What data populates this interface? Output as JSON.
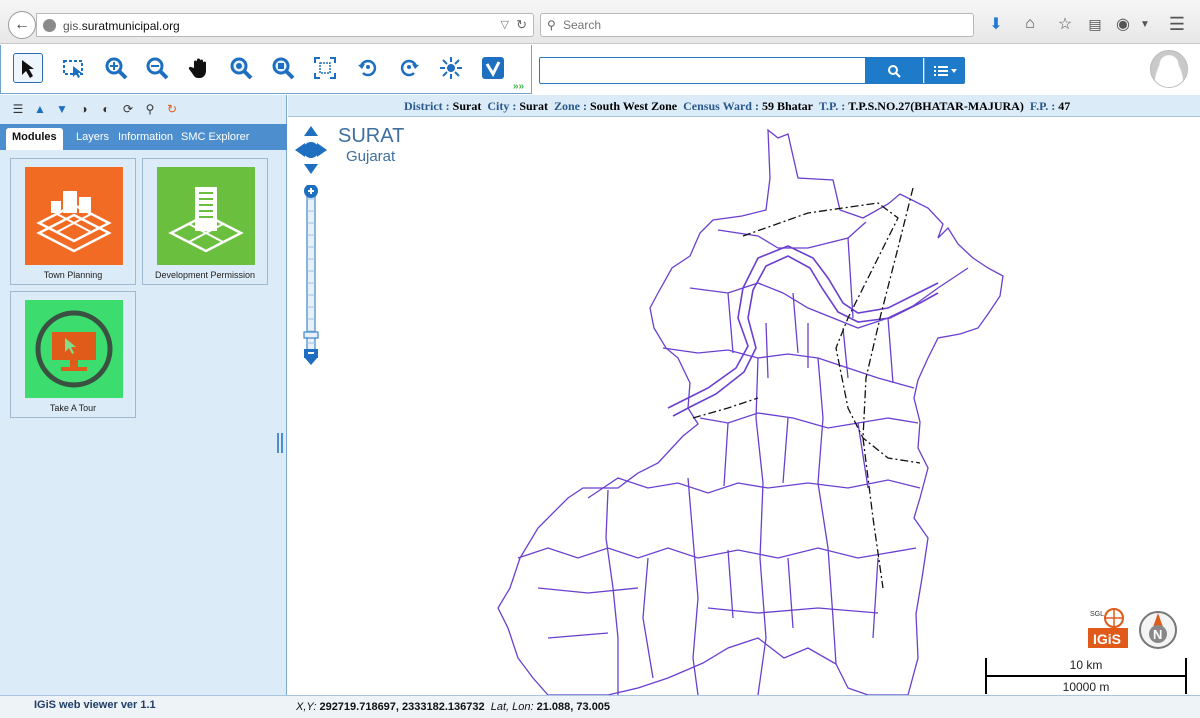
{
  "browser": {
    "url_prefix": "gis.",
    "url_domain": "suratmunicipal.org",
    "search_placeholder": "Search"
  },
  "toolbar": {
    "tools": [
      "select-arrow",
      "select-box",
      "zoom-in",
      "zoom-out",
      "pan",
      "zoom-in-alt",
      "zoom-out-alt",
      "full-extent",
      "previous-extent",
      "next-extent",
      "clear",
      "identify"
    ],
    "map_search_value": ""
  },
  "panel": {
    "tabs": [
      "Modules",
      "Layers",
      "Information",
      "SMC Explorer"
    ],
    "modules": [
      {
        "label": "Town Planning",
        "color": "#f26b24"
      },
      {
        "label": "Development Permission",
        "color": "#6bbf3f"
      },
      {
        "label": "Take A Tour",
        "color": "#3ddc6e"
      }
    ]
  },
  "info": {
    "district_label": "District :",
    "district": "Surat",
    "city_label": "City :",
    "city": "Surat",
    "zone_label": "Zone :",
    "zone": "South West Zone",
    "ward_label": "Census Ward :",
    "ward": "59 Bhatar",
    "tp_label": "T.P. :",
    "tp": "T.P.S.NO.27(BHATAR-MAJURA)",
    "fp_label": "F.P. :",
    "fp": "47"
  },
  "map": {
    "title": "SURAT",
    "subtitle": "Gujarat",
    "boundary_color": "#6a3fd0",
    "logo_text_top": "SGL",
    "logo_text_bottom": "IGiS",
    "north_label": "N",
    "scale_km": "10 km",
    "scale_m": "10000 m"
  },
  "status": {
    "version": "IGiS web viewer ver 1.1",
    "xy_label": "X,Y:",
    "xy": "292719.718697, 2333182.136732",
    "latlon_label": "Lat, Lon:",
    "latlon": "21.088, 73.005"
  }
}
